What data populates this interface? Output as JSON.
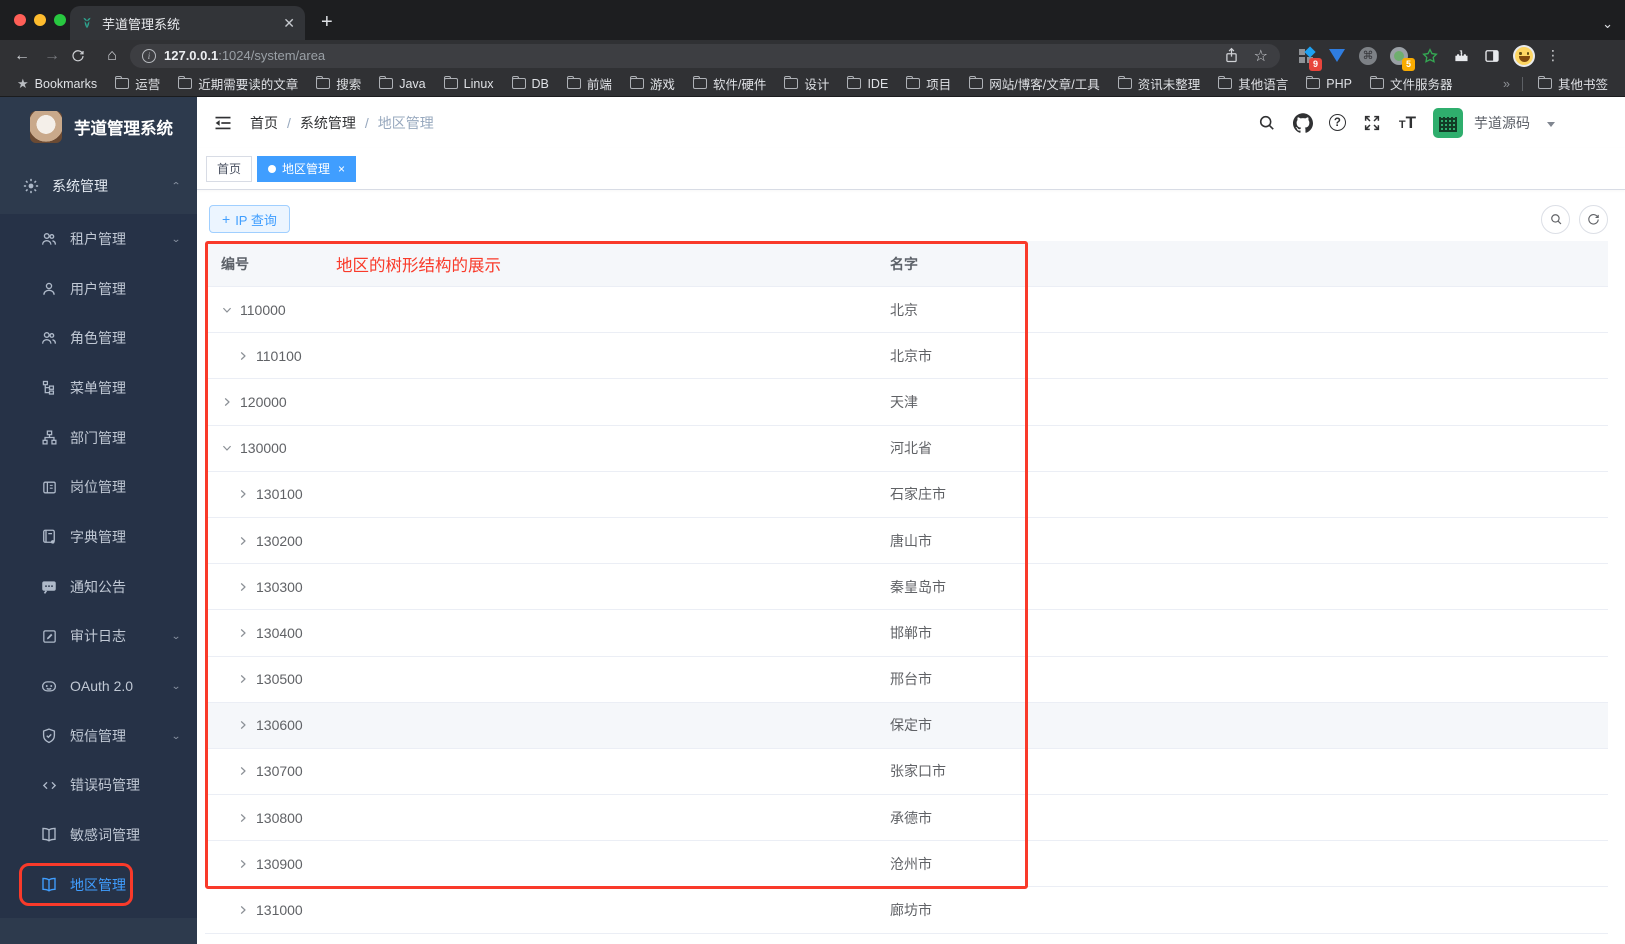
{
  "browser": {
    "tab_title": "芋道管理系统",
    "url_host": "127.0.0.1",
    "url_path": ":1024/system/area",
    "bookmarks": [
      "Bookmarks",
      "运营",
      "近期需要读的文章",
      "搜索",
      "Java",
      "Linux",
      "DB",
      "前端",
      "游戏",
      "软件/硬件",
      "设计",
      "IDE",
      "项目",
      "网站/博客/文章/工具",
      "资讯未整理",
      "其他语言",
      "PHP",
      "文件服务器"
    ],
    "bookmarks_overflow": "»",
    "other_bookmarks": "其他书签",
    "ext_badge_blue": "9",
    "ext_badge_green": "5"
  },
  "sidebar": {
    "title": "芋道管理系统",
    "root": {
      "label": "系统管理"
    },
    "items": [
      {
        "label": "租户管理"
      },
      {
        "label": "用户管理"
      },
      {
        "label": "角色管理"
      },
      {
        "label": "菜单管理"
      },
      {
        "label": "部门管理"
      },
      {
        "label": "岗位管理"
      },
      {
        "label": "字典管理"
      },
      {
        "label": "通知公告"
      },
      {
        "label": "审计日志"
      },
      {
        "label": "OAuth 2.0"
      },
      {
        "label": "短信管理"
      },
      {
        "label": "错误码管理"
      },
      {
        "label": "敏感词管理"
      },
      {
        "label": "地区管理"
      }
    ]
  },
  "navbar": {
    "breadcrumb": [
      "首页",
      "系统管理",
      "地区管理"
    ],
    "user_name": "芋道源码"
  },
  "tags": {
    "home": "首页",
    "active": "地区管理"
  },
  "toolbar": {
    "ip_query": "IP 查询"
  },
  "annotation": {
    "table_note": "地区的树形结构的展示"
  },
  "table": {
    "columns": [
      "编号",
      "名字"
    ],
    "rows": [
      {
        "id": "110000",
        "name": "北京"
      },
      {
        "id": "110100",
        "name": "北京市"
      },
      {
        "id": "120000",
        "name": "天津"
      },
      {
        "id": "130000",
        "name": "河北省"
      },
      {
        "id": "130100",
        "name": "石家庄市"
      },
      {
        "id": "130200",
        "name": "唐山市"
      },
      {
        "id": "130300",
        "name": "秦皇岛市"
      },
      {
        "id": "130400",
        "name": "邯郸市"
      },
      {
        "id": "130500",
        "name": "邢台市"
      },
      {
        "id": "130600",
        "name": "保定市"
      },
      {
        "id": "130700",
        "name": "张家口市"
      },
      {
        "id": "130800",
        "name": "承德市"
      },
      {
        "id": "130900",
        "name": "沧州市"
      },
      {
        "id": "131000",
        "name": "廊坊市"
      }
    ]
  },
  "colors": {
    "accent": "#409eff",
    "annotation_red": "#f93a2a",
    "sidebar_bg": "#2d3a4d",
    "submenu_bg": "#263247"
  }
}
